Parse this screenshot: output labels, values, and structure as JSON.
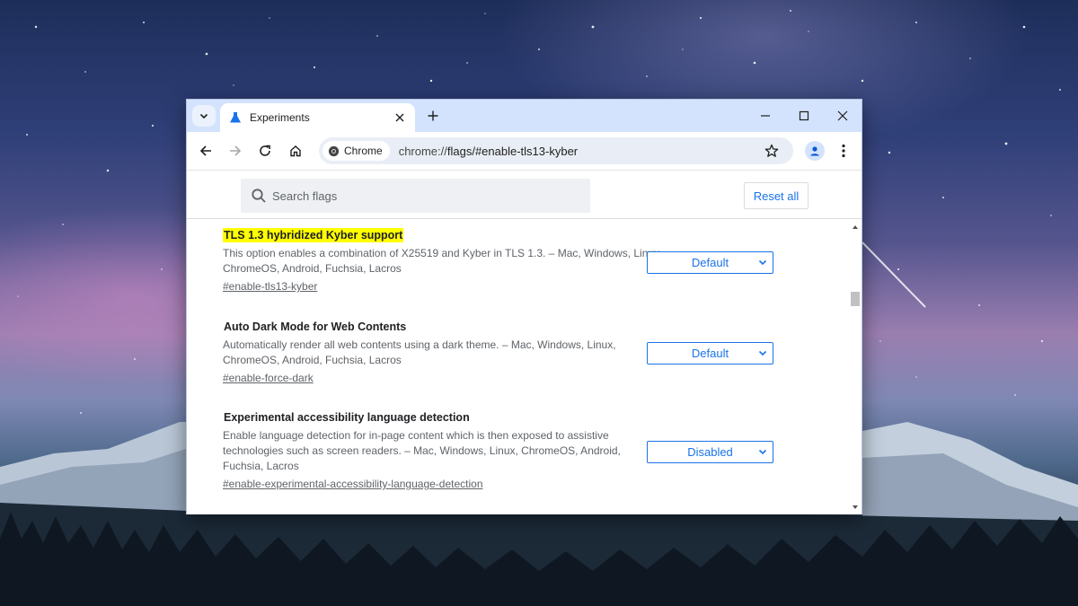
{
  "desktop": {
    "background": "starry night sky over snowy mountains with pine forest"
  },
  "browser": {
    "tab": {
      "title": "Experiments",
      "favicon": "flask-icon"
    },
    "toolbar": {
      "chip_label": "Chrome",
      "url_scheme": "chrome://",
      "url_path": "flags/#enable-tls13-kyber"
    },
    "colors": {
      "tabstrip": "#d3e3fd",
      "accent": "#1a73e8",
      "highlight": "#ffff00"
    }
  },
  "flags_page": {
    "search_placeholder": "Search flags",
    "reset_label": "Reset all",
    "flags": [
      {
        "name": "TLS 1.3 hybridized Kyber support",
        "description": "This option enables a combination of X25519 and Kyber in TLS 1.3. – Mac, Windows, Linux, ChromeOS, Android, Fuchsia, Lacros",
        "link": "#enable-tls13-kyber",
        "value": "Default",
        "highlighted": true
      },
      {
        "name": "Auto Dark Mode for Web Contents",
        "description": "Automatically render all web contents using a dark theme. – Mac, Windows, Linux, ChromeOS, Android, Fuchsia, Lacros",
        "link": "#enable-force-dark",
        "value": "Default",
        "highlighted": false
      },
      {
        "name": "Experimental accessibility language detection",
        "description": "Enable language detection for in-page content which is then exposed to assistive technologies such as screen readers. – Mac, Windows, Linux, ChromeOS, Android, Fuchsia, Lacros",
        "link": "#enable-experimental-accessibility-language-detection",
        "value": "Disabled",
        "highlighted": false
      }
    ]
  }
}
